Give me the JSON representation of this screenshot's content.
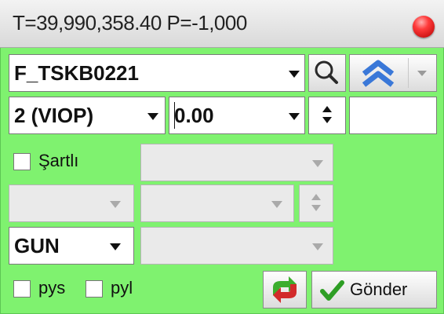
{
  "titlebar": {
    "text": "T=39,990,358.40 P=-1,000"
  },
  "symbol": {
    "value": "F_TSKB0221"
  },
  "market": {
    "value": "2 (VIOP)"
  },
  "price": {
    "value": "0.00"
  },
  "options": {
    "sartli_label": "Şartlı"
  },
  "validity": {
    "value": "GUN"
  },
  "bottom": {
    "pys_label": "pys",
    "pyl_label": "pyl",
    "send_label": "Gönder"
  },
  "colors": {
    "panel_bg": "#7ff26f",
    "accent_blue": "#2f6fd0"
  }
}
